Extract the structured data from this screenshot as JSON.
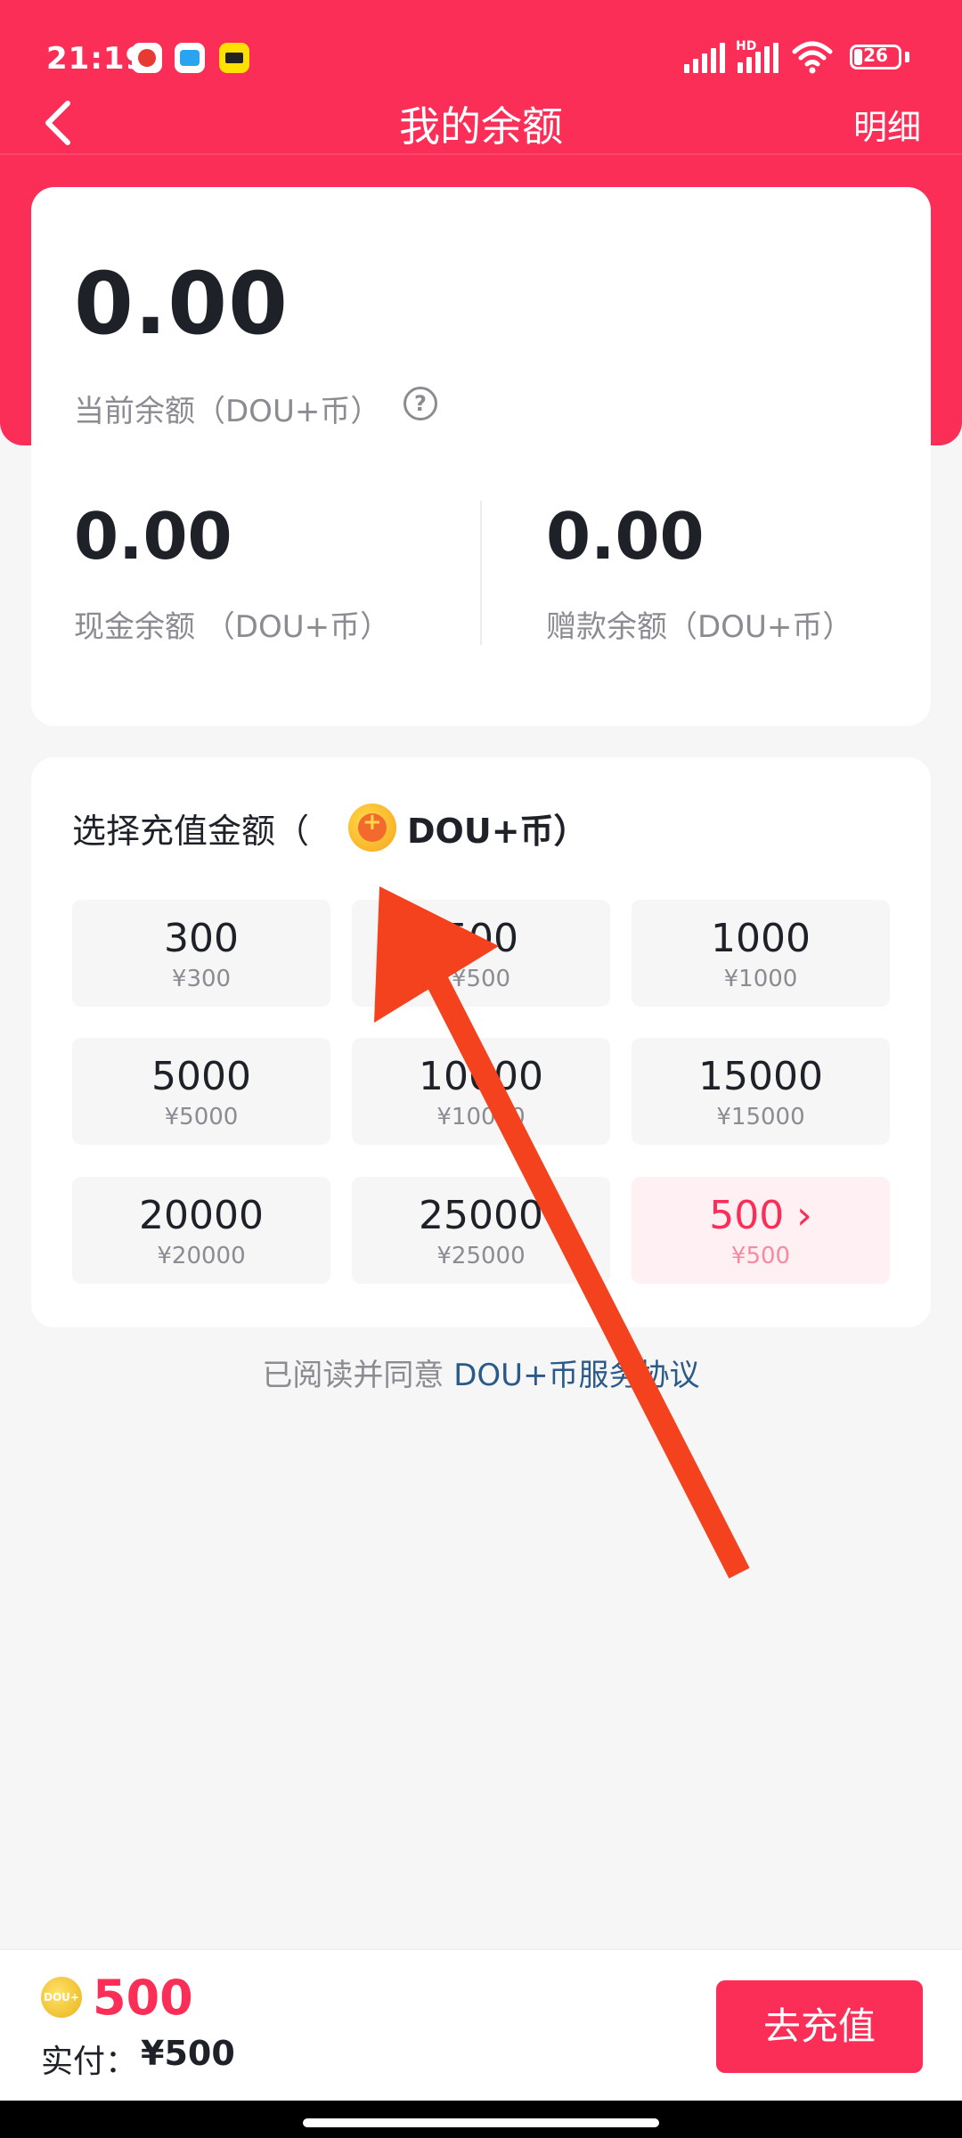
{
  "status_bar": {
    "time": "21:19",
    "battery": "26",
    "network_badge": "HD"
  },
  "nav": {
    "title": "我的余额",
    "detail_link": "明细"
  },
  "balance": {
    "current_value": "0.00",
    "current_label": "当前余额（DOU+币）",
    "cash_value": "0.00",
    "cash_label": "现金余额 （DOU+币）",
    "bonus_value": "0.00",
    "bonus_label": "赠款余额（DOU+币）"
  },
  "recharge": {
    "title_prefix": "选择充值金额（",
    "title_unit": "DOU+币）",
    "options": [
      {
        "amount": "300",
        "price": "¥300"
      },
      {
        "amount": "500",
        "price": "¥500"
      },
      {
        "amount": "1000",
        "price": "¥1000"
      },
      {
        "amount": "5000",
        "price": "¥5000"
      },
      {
        "amount": "10000",
        "price": "¥10000"
      },
      {
        "amount": "15000",
        "price": "¥15000"
      },
      {
        "amount": "20000",
        "price": "¥20000"
      },
      {
        "amount": "25000",
        "price": "¥25000"
      },
      {
        "amount": "500 ›",
        "price": "¥500",
        "selected": true
      }
    ]
  },
  "agreement": {
    "prefix": "已阅读并同意 ",
    "link": "DOU+币服务协议"
  },
  "bottom": {
    "coin_badge": "DOU+",
    "amount": "500",
    "pay_label": "实付：",
    "pay_value": "¥500",
    "button": "去充值"
  },
  "colors": {
    "brand": "#fb2e57",
    "annotation_arrow": "#f4411e"
  }
}
